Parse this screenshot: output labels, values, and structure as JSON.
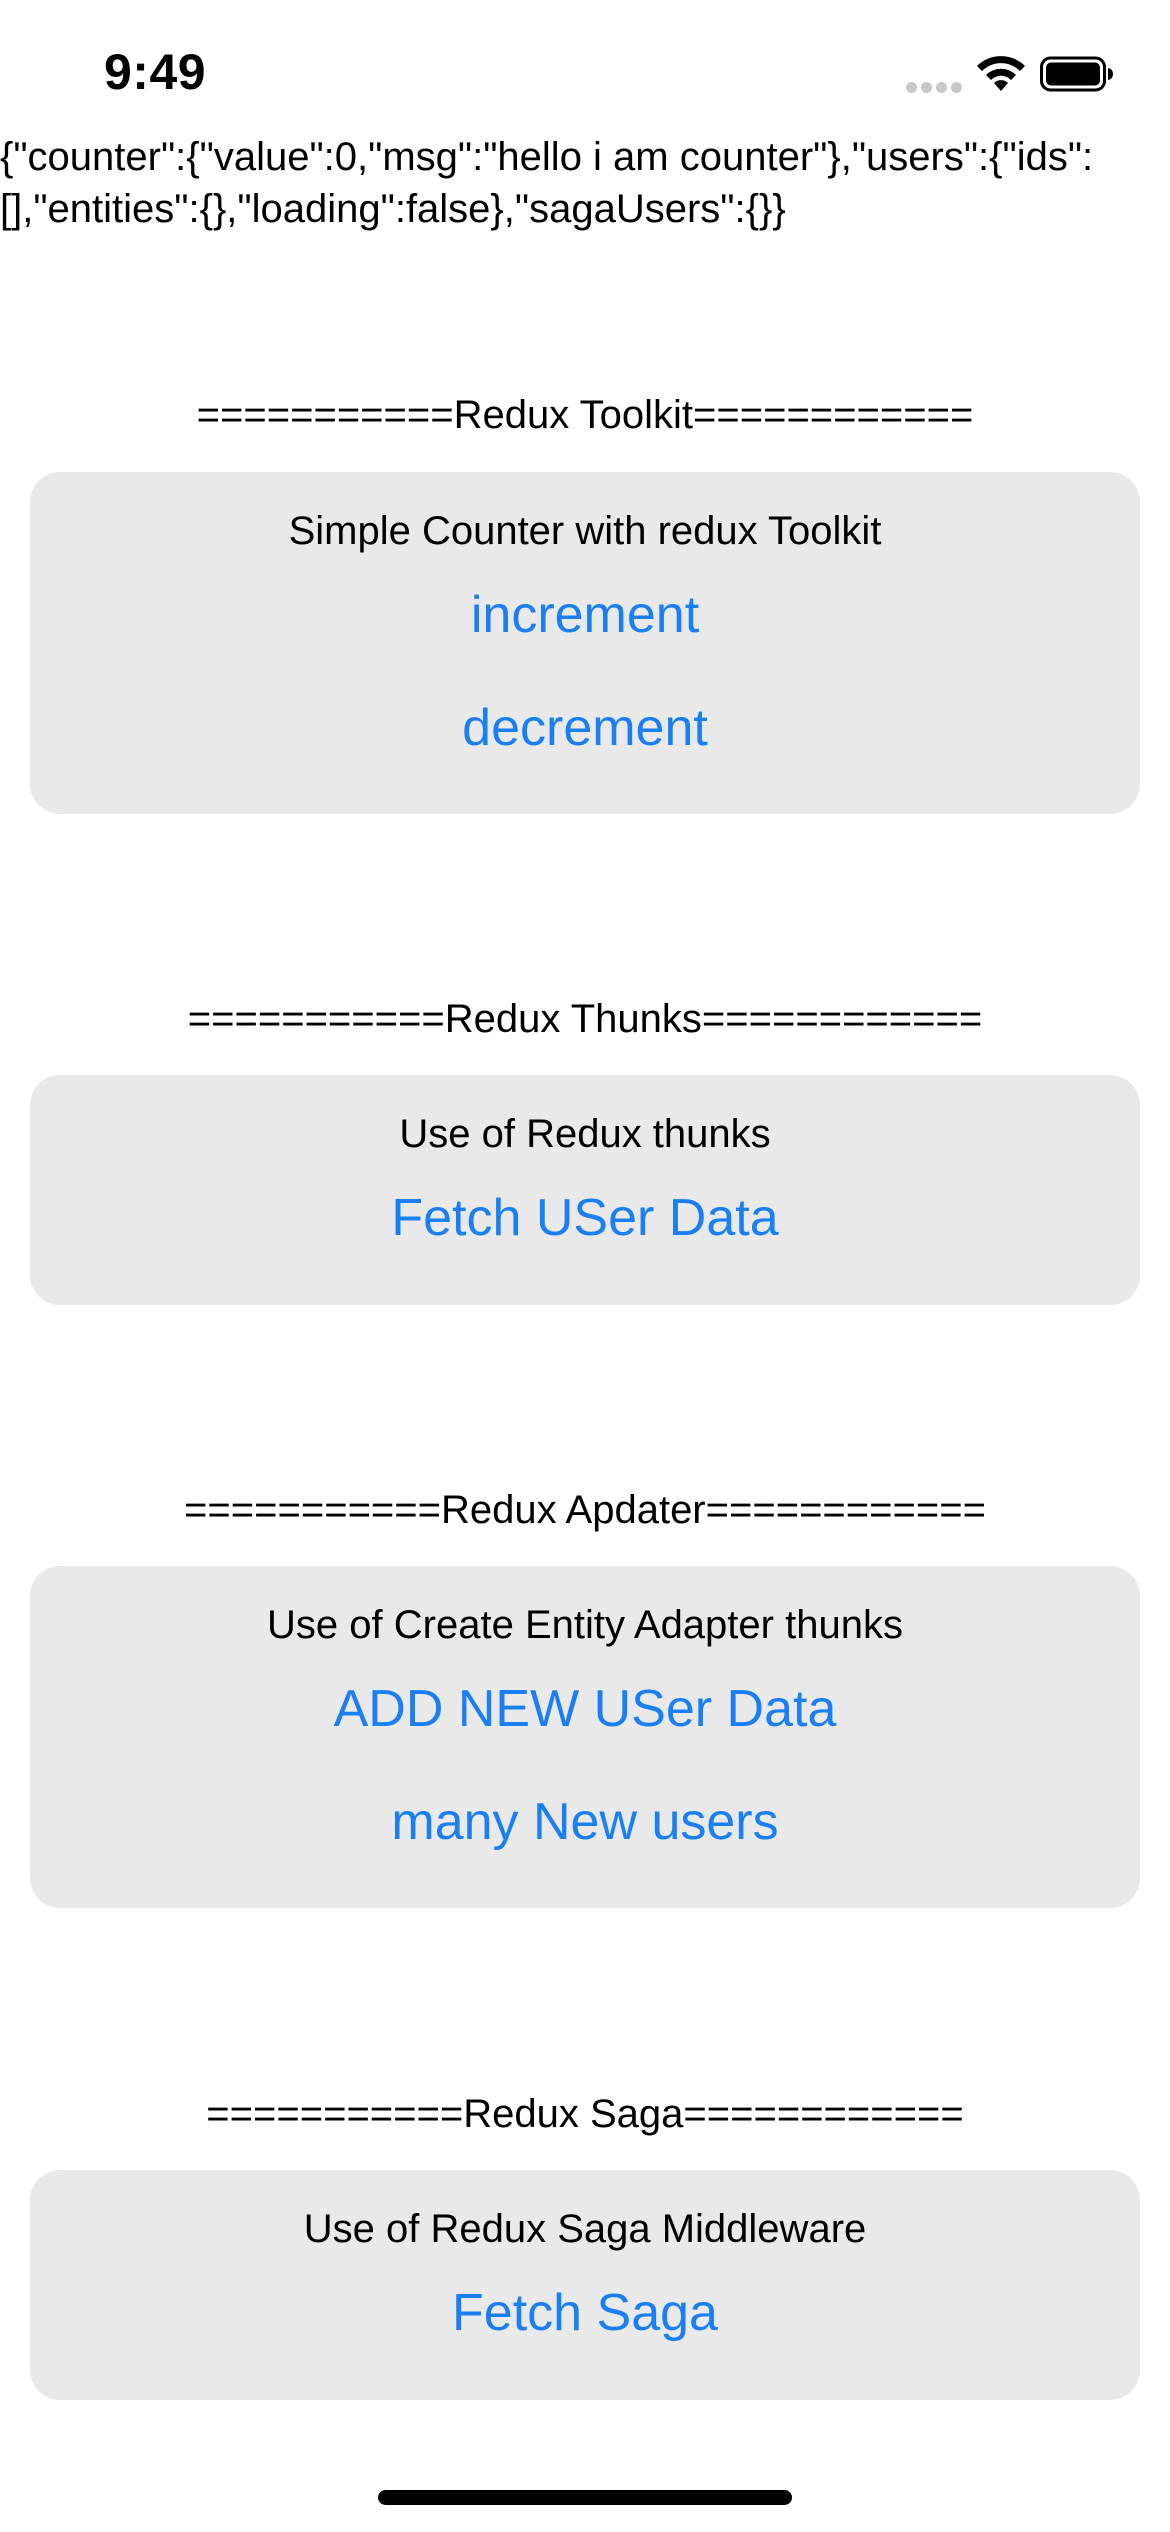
{
  "status_bar": {
    "time": "9:49",
    "icons": [
      "cellular-dots-icon",
      "wifi-icon",
      "battery-icon"
    ]
  },
  "state_dump": "{\"counter\":{\"value\":0,\"msg\":\"hello i am counter\"},\"users\":{\"ids\":[],\"entities\":{},\"loading\":false},\"sagaUsers\":{}}",
  "sections": {
    "toolkit": {
      "header": "===========Redux Toolkit============",
      "title": "Simple Counter with redux Toolkit",
      "buttons": [
        "increment",
        "decrement"
      ]
    },
    "thunks": {
      "header": "===========Redux Thunks============",
      "title": "Use of Redux thunks",
      "buttons": [
        "Fetch USer Data"
      ]
    },
    "adapter": {
      "header": "===========Redux Apdater============",
      "title": "Use of Create Entity Adapter thunks",
      "buttons": [
        "ADD NEW USer Data",
        "many New users"
      ]
    },
    "saga": {
      "header": "===========Redux Saga============",
      "title": "Use of Redux Saga Middleware",
      "buttons": [
        "Fetch Saga"
      ]
    }
  },
  "colors": {
    "accent": "#1a7ff2",
    "card_background": "#e9e9e9",
    "text": "#000000"
  }
}
